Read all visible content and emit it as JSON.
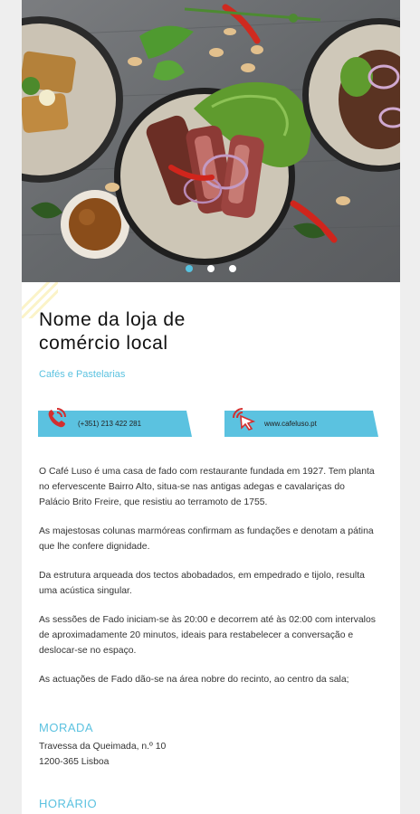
{
  "hero": {
    "image": "food-photo-steak-salad-bowls",
    "carousel": {
      "count": 3,
      "active_index": 0
    }
  },
  "store": {
    "title_line1": "Nome da loja de",
    "title_line2": "comércio local",
    "category": "Cafés e Pastelarias"
  },
  "contacts": {
    "phone_label": "(+351) 213 422 281",
    "phone_icon": "phone-icon",
    "web_label": "www.cafeluso.pt",
    "web_icon": "click-cursor-icon",
    "accent": "#57c3e0"
  },
  "description": [
    "O Café Luso é uma casa de fado com restaurante fundada em 1927. Tem planta no efervescente Bairro Alto, situa-se nas antigas adegas e cavalariças do Palácio Brito Freire, que resistiu ao terramoto de 1755.",
    "As majestosas colunas marmóreas confirmam as fundações e denotam a pátina que lhe confere dignidade.",
    "Da estrutura arqueada dos tectos abobadados, em empedrado e tijolo, resulta uma acústica singular.",
    "As sessões de Fado iniciam-se às 20:00 e decorrem até às 02:00 com intervalos de aproximadamente 20 minutos, ideais para restabelecer a conversação e deslocar-se no espaço.",
    "As actuações de Fado dão-se na área nobre do recinto, ao centro da sala;"
  ],
  "address": {
    "heading": "MORADA",
    "line1": "Travessa da Queimada, n.º 10",
    "line2": "1200-365 Lisboa"
  },
  "hours": {
    "heading": "HORÁRIO"
  }
}
